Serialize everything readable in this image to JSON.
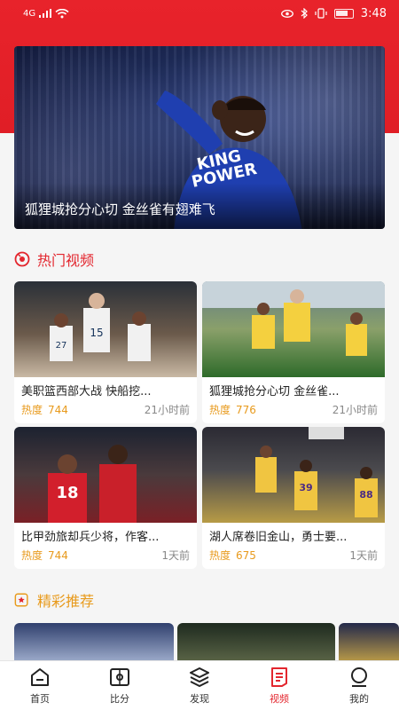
{
  "status_bar": {
    "network": "4G",
    "time": "3:48"
  },
  "banner": {
    "caption": "狐狸城抢分心切 金丝雀有翅难飞",
    "jersey_text": "KING POWER"
  },
  "hot_section": {
    "title": "热门视频",
    "heat_label": "热度",
    "cards": [
      {
        "title": "美职篮西部大战 快船挖...",
        "heat": "744",
        "time": "21小时前"
      },
      {
        "title": "狐狸城抢分心切 金丝雀...",
        "heat": "776",
        "time": "21小时前"
      },
      {
        "title": "比甲劲旅却兵少将，作客...",
        "heat": "744",
        "time": "1天前"
      },
      {
        "title": "湖人席卷旧金山，勇士要...",
        "heat": "675",
        "time": "1天前"
      }
    ]
  },
  "rec_section": {
    "title": "精彩推荐"
  },
  "tabbar": {
    "items": [
      {
        "label": "首页",
        "icon": "home-icon"
      },
      {
        "label": "比分",
        "icon": "score-icon"
      },
      {
        "label": "发现",
        "icon": "layers-icon"
      },
      {
        "label": "视频",
        "icon": "video-icon",
        "active": true
      },
      {
        "label": "我的",
        "icon": "profile-icon"
      }
    ]
  },
  "colors": {
    "brand_red": "#e3262e",
    "heat_orange": "#e89a1c"
  }
}
